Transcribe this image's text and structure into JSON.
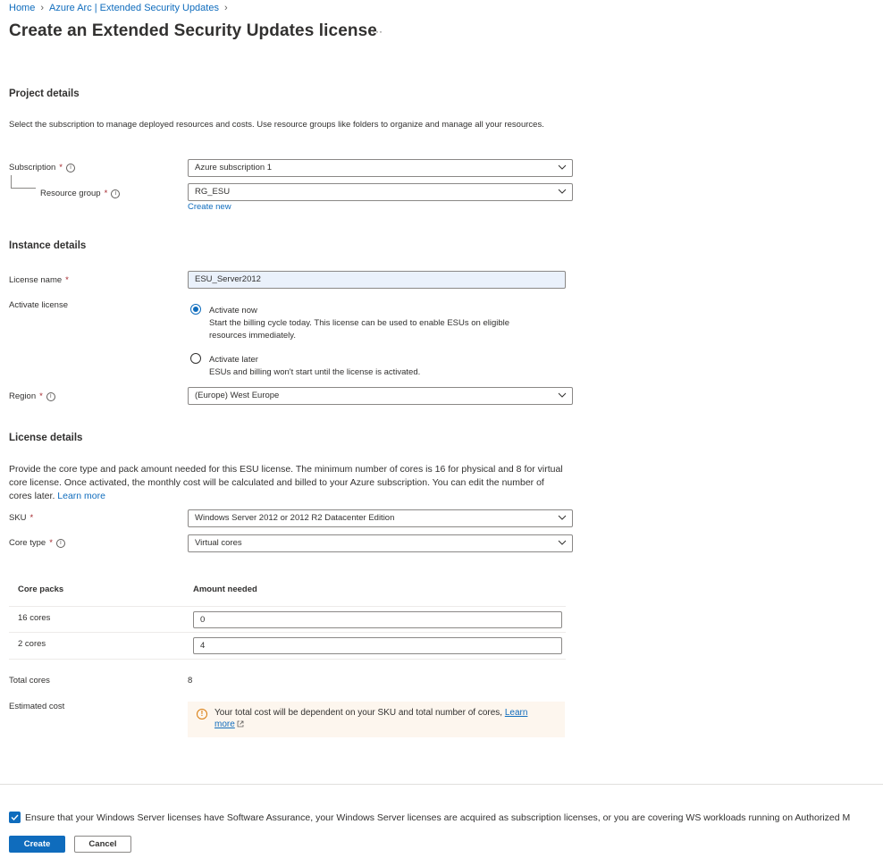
{
  "breadcrumb": {
    "home": "Home",
    "parent": "Azure Arc | Extended Security Updates"
  },
  "page": {
    "title": "Create an Extended Security Updates license",
    "more": "···"
  },
  "project": {
    "heading": "Project details",
    "description": "Select the subscription to manage deployed resources and costs. Use resource groups like folders to organize and manage all your resources.",
    "subscription_label": "Subscription",
    "subscription_value": "Azure subscription 1",
    "resource_group_label": "Resource group",
    "resource_group_value": "RG_ESU",
    "create_new": "Create new"
  },
  "instance": {
    "heading": "Instance details",
    "license_name_label": "License name",
    "license_name_value": "ESU_Server2012",
    "activate_label": "Activate license",
    "activate_now_title": "Activate now",
    "activate_now_desc": "Start the billing cycle today. This license can be used to enable ESUs on eligible resources immediately.",
    "activate_later_title": "Activate later",
    "activate_later_desc": "ESUs and billing won't start until the license is activated.",
    "selected": "Activate now",
    "region_label": "Region",
    "region_value": "(Europe) West Europe"
  },
  "license": {
    "heading": "License details",
    "description": "Provide the core type and pack amount needed for this ESU license. The minimum number of cores is 16 for physical and 8 for virtual core license. Once activated, the monthly cost will be calculated and billed to your Azure subscription. You can edit the number of cores later.",
    "learn_more": "Learn more",
    "sku_label": "SKU",
    "sku_value": "Windows Server 2012 or 2012 R2 Datacenter Edition",
    "core_type_label": "Core type",
    "core_type_value": "Virtual cores",
    "table": {
      "col_packs": "Core packs",
      "col_amount": "Amount needed",
      "rows": [
        {
          "pack": "16 cores",
          "amount": "0"
        },
        {
          "pack": "2 cores",
          "amount": "4"
        }
      ]
    },
    "total_cores_label": "Total cores",
    "total_cores_value": "8",
    "estimated_cost_label": "Estimated cost",
    "estimated_cost_note": "Your total cost will be dependent on your SKU and total number of cores,",
    "estimated_cost_link": "Learn more"
  },
  "footer": {
    "checkbox_checked": true,
    "checkbox_label": "Ensure that your Windows Server licenses have Software Assurance, your Windows Server licenses are acquired as subscription licenses, or you are covering WS workloads running on Authorized M",
    "create_button": "Create",
    "cancel_button": "Cancel"
  },
  "colors": {
    "accent": "#0f6cbd",
    "required": "#a4262c",
    "warning": "#d97c0d",
    "note_background": "#fdf6ee"
  },
  "icons": [
    "chevron-right-icon",
    "info-icon",
    "chevron-down-icon",
    "warning-icon",
    "external-link-icon",
    "checkmark-icon"
  ]
}
